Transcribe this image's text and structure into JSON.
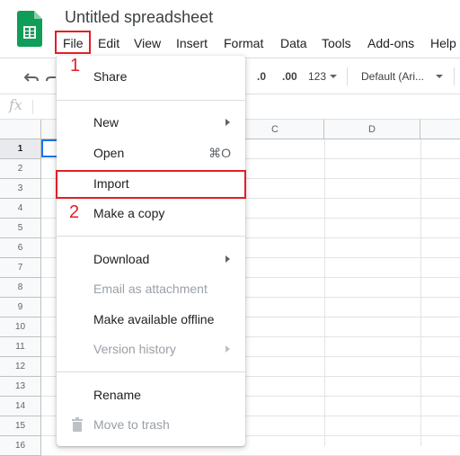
{
  "app": {
    "doc_title": "Untitled spreadsheet",
    "logo_icon": "google-sheets-icon"
  },
  "menubar": {
    "items": [
      "File",
      "Edit",
      "View",
      "Insert",
      "Format",
      "Data",
      "Tools",
      "Add-ons",
      "Help"
    ]
  },
  "toolbar": {
    "decrease_decimal": ".0",
    "increase_decimal": ".00",
    "more_formats": "123",
    "font": "Default (Ari..."
  },
  "formula_bar": {
    "fx_label": "fx"
  },
  "grid": {
    "columns": [
      "C",
      "D"
    ],
    "rows": [
      "1",
      "2",
      "3",
      "4",
      "5",
      "6",
      "7",
      "8",
      "9",
      "10",
      "11",
      "12",
      "13",
      "14",
      "15",
      "16"
    ],
    "selected_cell": "A1"
  },
  "file_menu": {
    "items": [
      {
        "label": "Share",
        "enabled": true
      },
      {
        "label": "New",
        "enabled": true,
        "submenu": true
      },
      {
        "label": "Open",
        "enabled": true,
        "shortcut": "⌘O"
      },
      {
        "label": "Import",
        "enabled": true
      },
      {
        "label": "Make a copy",
        "enabled": true
      },
      {
        "label": "Download",
        "enabled": true,
        "submenu": true
      },
      {
        "label": "Email as attachment",
        "enabled": false
      },
      {
        "label": "Make available offline",
        "enabled": true
      },
      {
        "label": "Version history",
        "enabled": false,
        "submenu": true
      },
      {
        "label": "Rename",
        "enabled": true
      },
      {
        "label": "Move to trash",
        "enabled": false,
        "icon": "trash-icon"
      }
    ]
  },
  "annotations": {
    "step1": "1",
    "step2": "2",
    "highlight_color": "#e41e26"
  }
}
